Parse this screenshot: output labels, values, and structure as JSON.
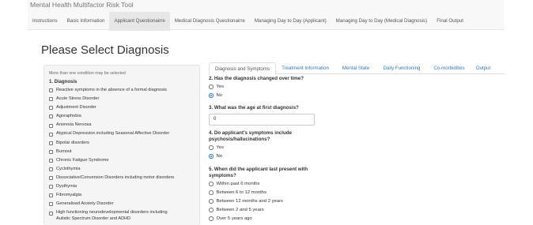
{
  "app": {
    "title": "Mental Health Multifactor Risk Tool"
  },
  "main_tabs": [
    "Instructions",
    "Basic Information",
    "Applicant Questionairre",
    "Medical Diagnosis Questionairre",
    "Managing Day to Day (Applicant)",
    "Managing Day to Day (Medical Diagnosis)",
    "Final Output"
  ],
  "active_main_tab": 2,
  "page_title": "Please Select Diagnosis",
  "diagnosis": {
    "help_text": "More than one condition may be selected",
    "heading": "1. Diagnosis",
    "options": [
      "Reactive symptoms in the absence of a formal diagnosis",
      "Acute Stress Disorder",
      "Adjustment Disorder",
      "Agoraphobia",
      "Anorexia Nervosa",
      "Atypical Depression including Seasonal Affective Disorder",
      "Bipolar disorders",
      "Burnout",
      "Chronic Fatigue Syndrome",
      "Cyclothymia",
      "Dissociative/Conversion Disorders including motor disorders",
      "Dysthymia",
      "Fibromyalgia",
      "Generalised Anxiety Disorder",
      "High functioning neurodevelopmental disorders including",
      "Autistic Spectrum Disorder and ADHD"
    ]
  },
  "sub_tabs": [
    "Diagnosis and Symptoms",
    "Treatment Information",
    "Mental State",
    "Daily Functioning",
    "Co-morbidities",
    "Output"
  ],
  "active_sub_tab": 0,
  "q2": {
    "label": "2. Has the diagnosis changed over time?",
    "options": [
      "Yes",
      "No"
    ],
    "selected": "No"
  },
  "q3": {
    "label": "3. What was the age at first diagnosis?",
    "value": "0"
  },
  "q4": {
    "label_line1": "4. Do applicant's symptoms include",
    "label_line2": "psychosis/hallucinations?",
    "options": [
      "Yes",
      "No"
    ],
    "selected": "No"
  },
  "q5": {
    "label_line1": "5. When did the applicant last present with",
    "label_line2": "symptoms?",
    "options": [
      "Within past 6 months",
      "Between 6 to 12 months",
      "Between 12 months and 2 years",
      "Between 2 and 5 years",
      "Over 5 years ago"
    ],
    "selected": null
  },
  "colors": {
    "link": "#337ab7",
    "radio_selected": "#2a7ae2",
    "navbar_bg": "#f8f8f8",
    "well_bg": "#f5f5f5"
  }
}
